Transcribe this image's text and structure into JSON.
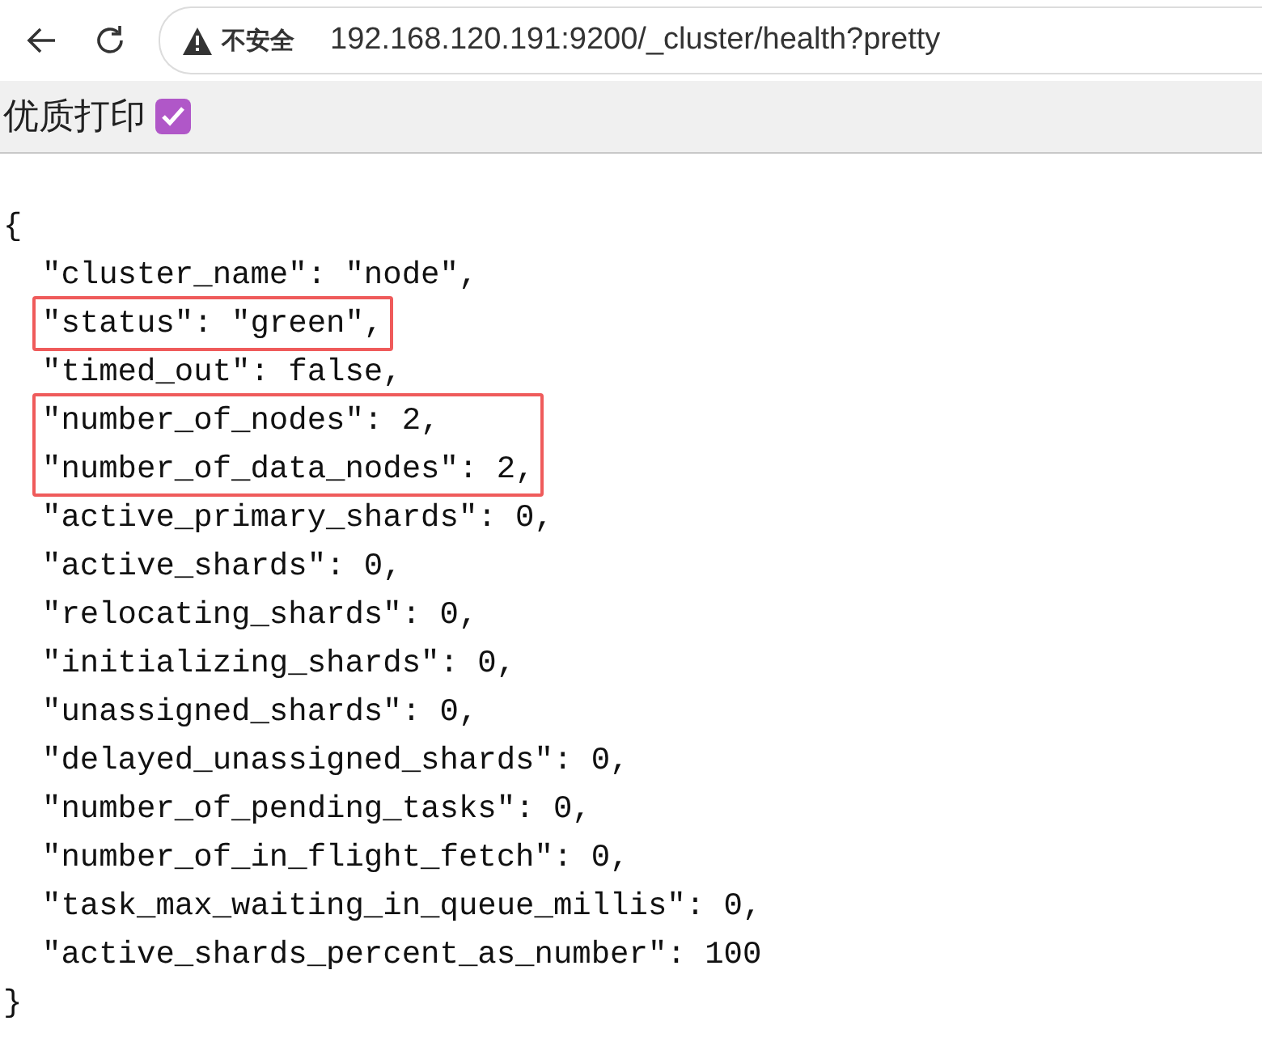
{
  "browser": {
    "security_label": "不安全",
    "url": "192.168.120.191:9200/_cluster/health?pretty"
  },
  "print_bar": {
    "label": "优质打印",
    "checked": true
  },
  "document": {
    "open": "{",
    "close": "}",
    "blocks": [
      {
        "highlighted": false,
        "lines": [
          "\"cluster_name\": \"node\","
        ]
      },
      {
        "highlighted": true,
        "lines": [
          "\"status\": \"green\","
        ]
      },
      {
        "highlighted": false,
        "lines": [
          "\"timed_out\": false,"
        ]
      },
      {
        "highlighted": true,
        "lines": [
          "\"number_of_nodes\": 2,",
          "\"number_of_data_nodes\": 2,"
        ]
      },
      {
        "highlighted": false,
        "lines": [
          "\"active_primary_shards\": 0,",
          "\"active_shards\": 0,",
          "\"relocating_shards\": 0,",
          "\"initializing_shards\": 0,",
          "\"unassigned_shards\": 0,",
          "\"delayed_unassigned_shards\": 0,",
          "\"number_of_pending_tasks\": 0,",
          "\"number_of_in_flight_fetch\": 0,",
          "\"task_max_waiting_in_queue_millis\": 0,",
          "\"active_shards_percent_as_number\": 100"
        ]
      }
    ]
  }
}
